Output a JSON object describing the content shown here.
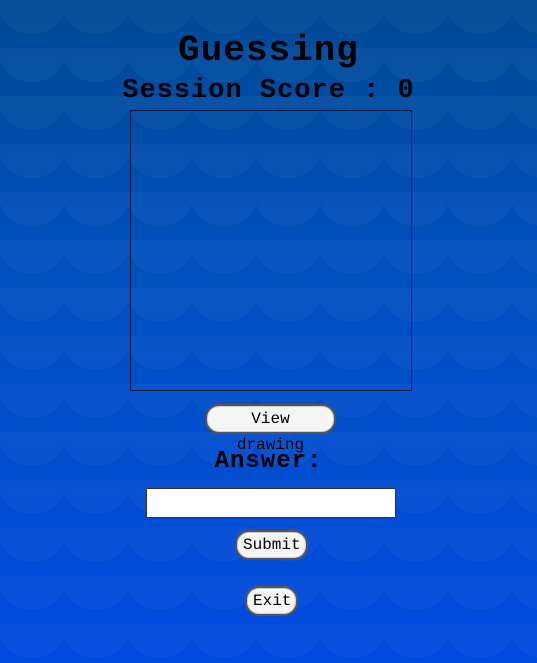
{
  "page": {
    "title": "Guessing",
    "score_label": "Session Score : ",
    "score_value": "0"
  },
  "drawing": {
    "view_button_label": "View drawing"
  },
  "answer": {
    "label": "Answer:",
    "value": "",
    "placeholder": ""
  },
  "actions": {
    "submit_label": "Submit",
    "exit_label": "Exit"
  },
  "colors": {
    "background_top": "#004a94",
    "background_bottom": "#004ae0",
    "text": "#000000",
    "button_bg": "#f5f5f5"
  }
}
